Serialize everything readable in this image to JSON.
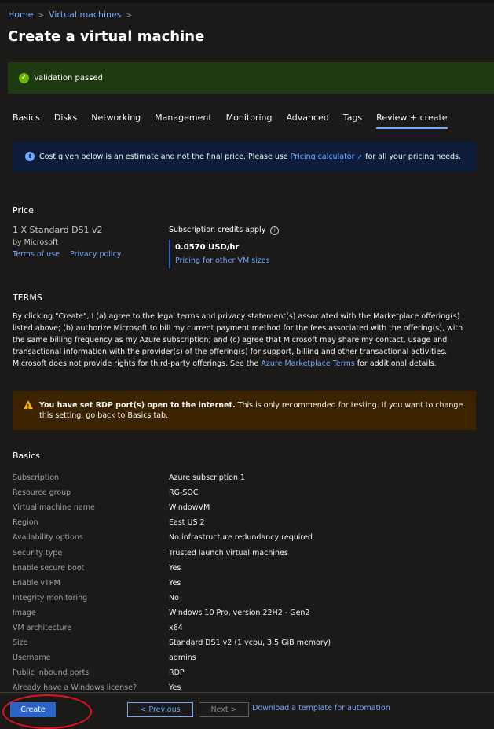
{
  "breadcrumb": {
    "home": "Home",
    "vms": "Virtual machines"
  },
  "page": {
    "title": "Create a virtual machine",
    "more": "···"
  },
  "validation": {
    "text": "Validation passed"
  },
  "tabs": [
    "Basics",
    "Disks",
    "Networking",
    "Management",
    "Monitoring",
    "Advanced",
    "Tags",
    "Review + create"
  ],
  "info": {
    "before": "Cost given below is an estimate and not the final price. Please use",
    "link": "Pricing calculator",
    "after": "for all your pricing needs."
  },
  "price": {
    "heading": "Price",
    "sku": "1 X Standard DS1 v2",
    "by": "by Microsoft",
    "terms_link": "Terms of use",
    "privacy_link": "Privacy policy",
    "credits": "Subscription credits apply",
    "cost": "0.0570 USD/hr",
    "other_link": "Pricing for other VM sizes"
  },
  "terms": {
    "heading": "TERMS",
    "body_before": "By clicking \"Create\", I (a) agree to the legal terms and privacy statement(s) associated with the Marketplace offering(s) listed above; (b) authorize Microsoft to bill my current payment method for the fees associated with the offering(s), with the same billing frequency as my Azure subscription; and (c) agree that Microsoft may share my contact, usage and transactional information with the provider(s) of the offering(s) for support, billing and other transactional activities. Microsoft does not provide rights for third-party offerings. See the",
    "link": "Azure Marketplace Terms",
    "body_after": "for additional details."
  },
  "warning": {
    "bold": "You have set RDP port(s) open to the internet.",
    "text": "This is only recommended for testing.  If you want to change this setting, go back to Basics tab."
  },
  "basics": {
    "heading": "Basics",
    "rows": [
      {
        "k": "Subscription",
        "v": "Azure subscription 1"
      },
      {
        "k": "Resource group",
        "v": "RG-SOC"
      },
      {
        "k": "Virtual machine name",
        "v": "WindowVM"
      },
      {
        "k": "Region",
        "v": "East US 2"
      },
      {
        "k": "Availability options",
        "v": "No infrastructure redundancy required"
      },
      {
        "k": "Security type",
        "v": "Trusted launch virtual machines"
      },
      {
        "k": "Enable secure boot",
        "v": "Yes"
      },
      {
        "k": "Enable vTPM",
        "v": "Yes"
      },
      {
        "k": "Integrity monitoring",
        "v": "No"
      },
      {
        "k": "Image",
        "v": "Windows 10 Pro, version 22H2 - Gen2"
      },
      {
        "k": "VM architecture",
        "v": "x64"
      },
      {
        "k": "Size",
        "v": "Standard DS1 v2 (1 vcpu, 3.5 GiB memory)"
      },
      {
        "k": "Username",
        "v": "admins"
      },
      {
        "k": "Public inbound ports",
        "v": "RDP"
      },
      {
        "k": "Already have a Windows license?",
        "v": "Yes"
      }
    ]
  },
  "footer": {
    "create": "Create",
    "previous": "< Previous",
    "next": "Next >",
    "download": "Download a template for automation"
  }
}
